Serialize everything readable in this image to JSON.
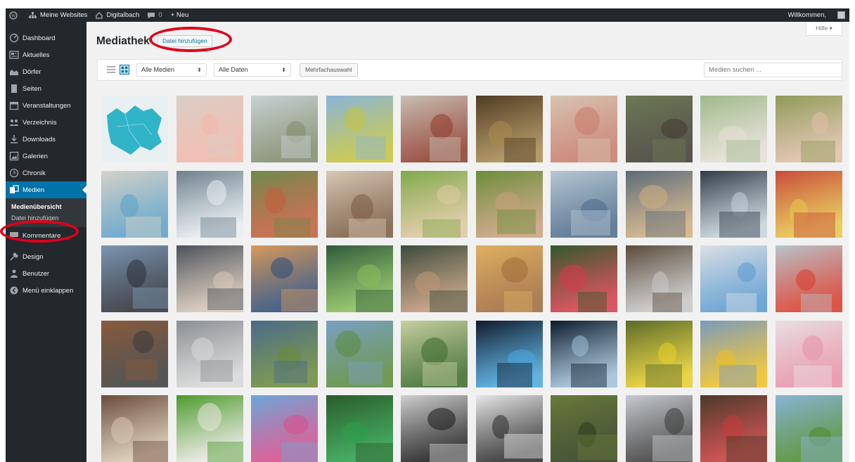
{
  "adminbar": {
    "sites_label": "Meine Websites",
    "site_name": "Digitalbach",
    "comment_count": "0",
    "new_label": "+ Neu",
    "welcome": "Willkommen,"
  },
  "sidebar": {
    "items": [
      {
        "label": "Dashboard",
        "icon": "dashboard-icon"
      },
      {
        "label": "Aktuelles",
        "icon": "news-icon"
      },
      {
        "label": "Dörfer",
        "icon": "villages-icon"
      },
      {
        "label": "Seiten",
        "icon": "pages-icon"
      },
      {
        "label": "Veranstaltungen",
        "icon": "calendar-icon"
      },
      {
        "label": "Verzeichnis",
        "icon": "directory-icon"
      },
      {
        "label": "Downloads",
        "icon": "download-icon"
      },
      {
        "label": "Galerien",
        "icon": "gallery-icon"
      },
      {
        "label": "Chronik",
        "icon": "history-icon"
      },
      {
        "label": "Medien",
        "icon": "media-icon"
      },
      {
        "label": "Kommentare",
        "icon": "comments-icon"
      },
      {
        "label": "Design",
        "icon": "design-icon"
      },
      {
        "label": "Benutzer",
        "icon": "users-icon"
      },
      {
        "label": "Menü einklappen",
        "icon": "collapse-icon"
      }
    ],
    "submenu": [
      "Medienübersicht",
      "Datei hinzufügen"
    ]
  },
  "page": {
    "title": "Mediathek",
    "add_new": "Datei hinzufügen",
    "help": "Hilfe ▾"
  },
  "toolbar": {
    "filter_type": "Alle Medien",
    "filter_date": "Alle Daten",
    "bulk_select": "Mehrfachauswahl",
    "search_placeholder": "Medien suchen ..."
  },
  "colors": {
    "admin_dark": "#23282d",
    "accent": "#0073aa",
    "highlight_ring": "#e0001a"
  },
  "media": [
    "map-thumbnail",
    "woman-phone-thumbnail",
    "aerial-city-thumbnail",
    "field-road-thumbnail",
    "man-phone-thumbnail",
    "potato-harvest-thumbnail",
    "two-women-tea-thumbnail",
    "old-man-thumbnail",
    "woman-cart-thumbnail",
    "woman-garden-thumbnail",
    "pharmacy-tablet-thumbnail",
    "kids-screen-thumbnail",
    "couple-flowers-thumbnail",
    "woman-laptop-thumbnail",
    "woman-glasses-thumbnail",
    "woman-smartphone-thumbnail",
    "woman-office-thumbnail",
    "girl-book-thumbnail",
    "buildings-man-thumbnail",
    "woman-supermarket-thumbnail",
    "drone-thumbnail",
    "man-tablet-thumbnail",
    "kid-laptop-thumbnail",
    "leaf-hand-thumbnail",
    "boy-chalkboard-thumbnail",
    "woman-field-thumbnail",
    "grandpa-kids-thumbnail",
    "boy-clarinet-thumbnail",
    "woman-tablet-thumbnail",
    "car-breakdown-thumbnail",
    "man-sleeping-thumbnail",
    "traffic-jam-thumbnail",
    "windfarm-landscape-thumbnail",
    "farmer-tablet-thumbnail",
    "tablet-blueberries-thumbnail",
    "tech-hand-thumbnail",
    "globe-network-thumbnail",
    "goalkeeper-thumbnail",
    "rubber-duck-thumbnail",
    "pink-roses-thumbnail",
    "man-desk-thumbnail",
    "green-field-line-thumbnail",
    "flower-field-thumbnail",
    "soccer-player-thumbnail",
    "chess-thumbnail",
    "calculator-thumbnail",
    "aerial-farmland-thumbnail",
    "handshake-tablet-thumbnail",
    "strawberries-thumbnail",
    "tractor-field-thumbnail"
  ]
}
